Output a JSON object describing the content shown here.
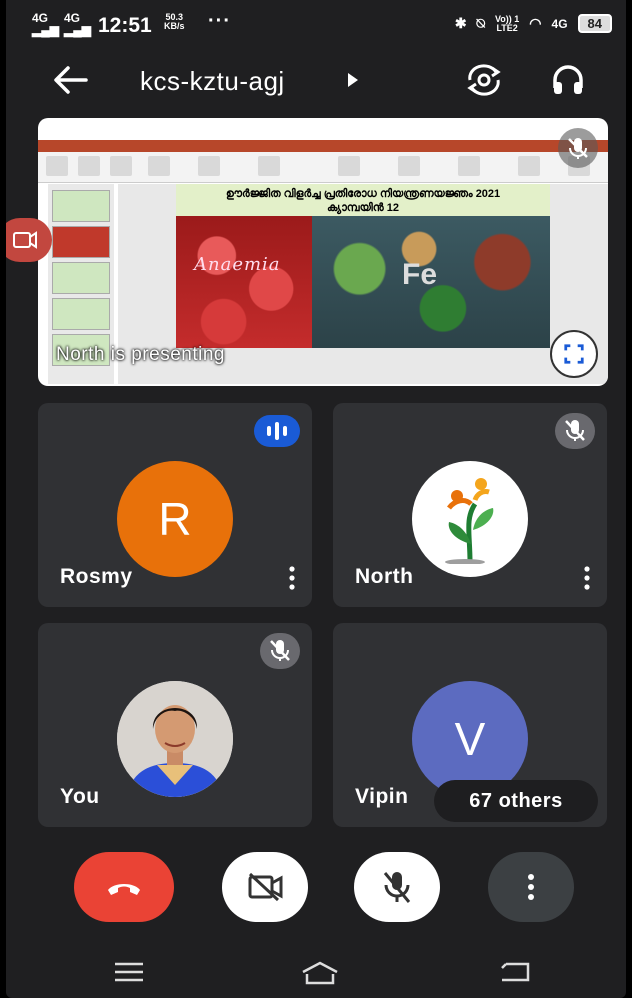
{
  "status_bar": {
    "net1": "4G",
    "net2": "4G",
    "time": "12:51",
    "speed_value": "50.3",
    "speed_unit": "KB/s",
    "dots": "···",
    "volte_top": "Vo)) 1",
    "volte_bottom": "LTE2",
    "net3": "4G",
    "battery": "84"
  },
  "header": {
    "meeting_code": "kcs-kztu-agj"
  },
  "presentation": {
    "slide_title_line1": "ഊർജ്ജിത വിളർച്ച പ്രതിരോധ നിയന്ത്രണയജ്ഞം 2021",
    "slide_title_line2": "ക്യാമ്പയിൻ 12",
    "slide_left_word": "Anaemia",
    "slide_right_word": "Fe",
    "presenting_text": "North is presenting"
  },
  "participants": [
    {
      "name": "Rosmy",
      "initial": "R",
      "avatar_color": "#e8710a",
      "state": "speaking"
    },
    {
      "name": "North",
      "initial": "",
      "avatar_color": "#ffffff",
      "state": "muted"
    },
    {
      "name": "You",
      "initial": "",
      "avatar_color": "#cfd8dc",
      "state": "muted"
    },
    {
      "name": "Vipin",
      "initial": "V",
      "avatar_color": "#5c6bc0",
      "state": "none"
    }
  ],
  "others_count_label": "67 others",
  "controls": [
    "end-call",
    "camera-off",
    "mic-off",
    "more-options"
  ],
  "colors": {
    "hangup": "#ea4335",
    "speaking": "#1a5bd6",
    "tile": "#303134",
    "background": "#1f1f21"
  }
}
